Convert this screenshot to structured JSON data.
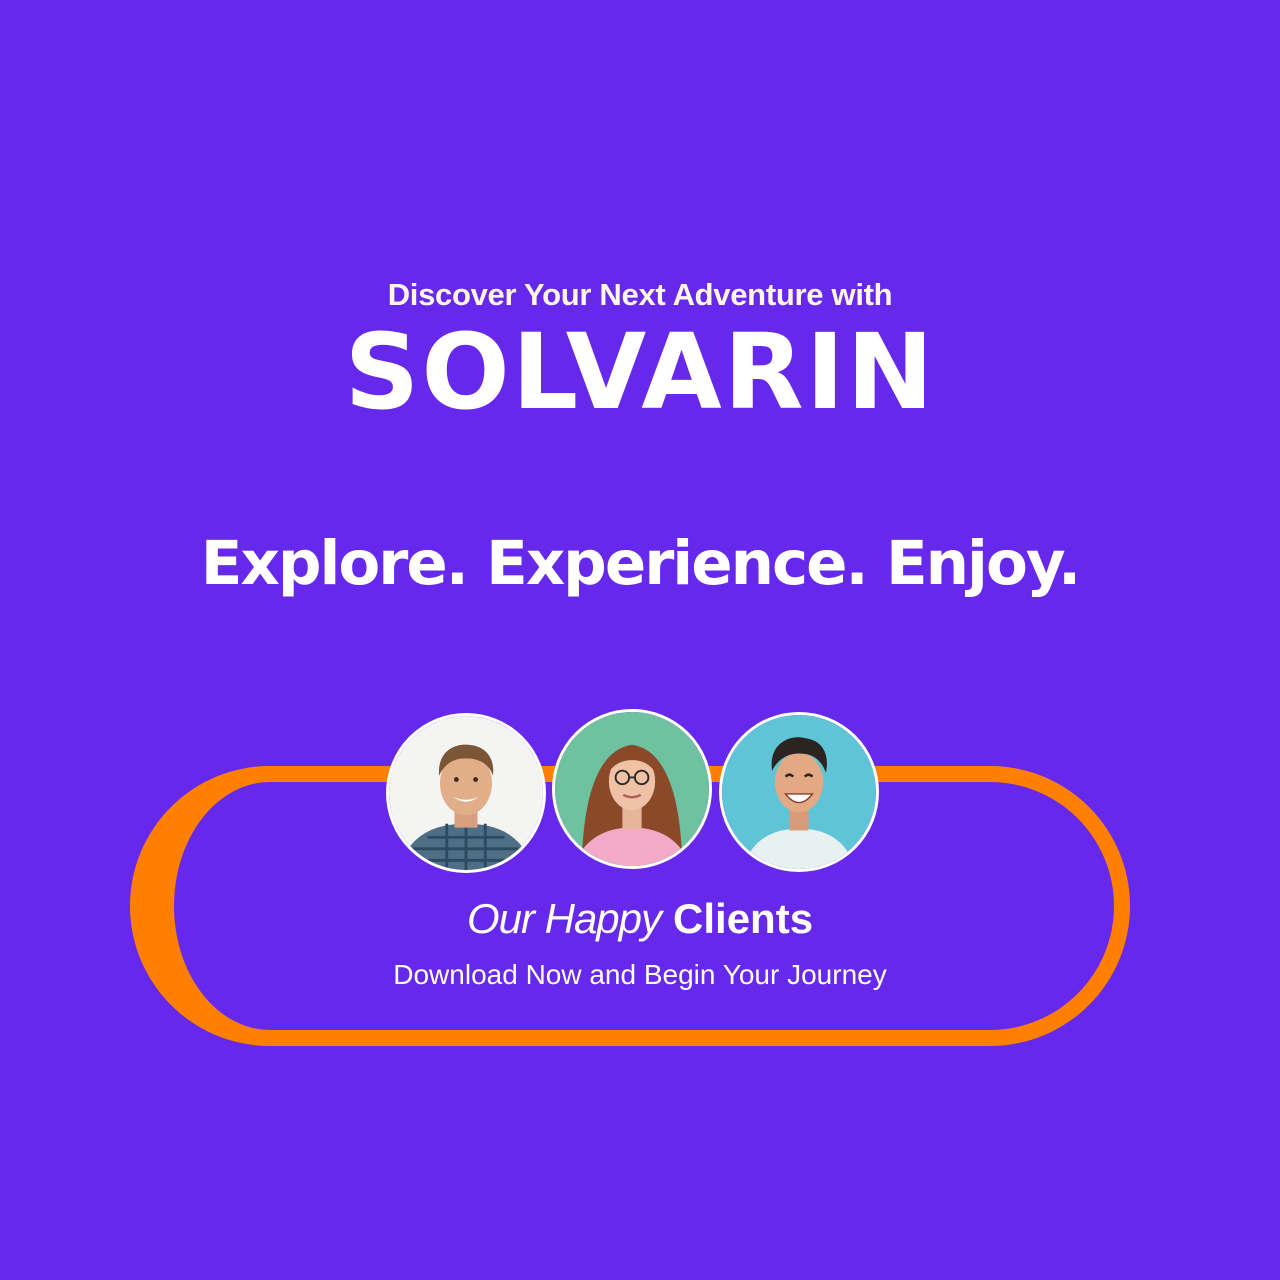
{
  "hero": {
    "intro": "Discover Your Next Adventure with",
    "brand": "SOLVARIN",
    "motto": "Explore. Experience. Enjoy."
  },
  "clients": {
    "heading_light": "Our Happy",
    "heading_bold": "Clients",
    "subtitle": "Download Now and Begin Your Journey",
    "avatars": [
      {
        "icon": "smiling-man-avatar"
      },
      {
        "icon": "woman-with-glasses-avatar"
      },
      {
        "icon": "laughing-man-avatar"
      }
    ]
  },
  "colors": {
    "background": "#6629EC",
    "accent_ring": "#FF8000",
    "text": "#FFFFFF"
  }
}
